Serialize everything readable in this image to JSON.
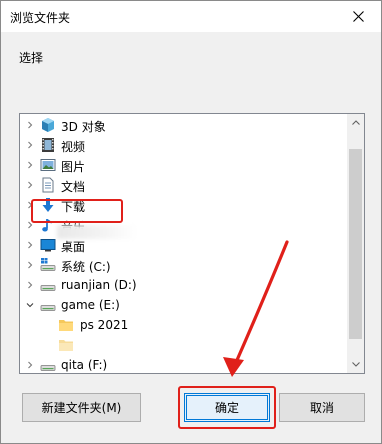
{
  "window": {
    "title": "浏览文件夹"
  },
  "prompt": "选择",
  "tree": {
    "items": [
      {
        "label": "3D 对象",
        "icon": "3d-objects-icon",
        "expanded": false
      },
      {
        "label": "视频",
        "icon": "videos-icon",
        "expanded": false
      },
      {
        "label": "图片",
        "icon": "pictures-icon",
        "expanded": false
      },
      {
        "label": "文档",
        "icon": "documents-icon",
        "expanded": false
      },
      {
        "label": "下载",
        "icon": "downloads-icon",
        "expanded": false
      },
      {
        "label": "音乐",
        "icon": "music-icon",
        "expanded": false
      },
      {
        "label": "桌面",
        "icon": "desktop-icon",
        "expanded": false
      },
      {
        "label": "系统 (C:)",
        "icon": "drive-icon",
        "expanded": false
      },
      {
        "label": "ruanjian (D:)",
        "icon": "drive-icon",
        "expanded": false
      },
      {
        "label": "game (E:)",
        "icon": "drive-icon",
        "expanded": true
      },
      {
        "label": "ps 2021",
        "icon": "folder-icon",
        "expanded": false
      },
      {
        "label": "qita (F:)",
        "icon": "drive-icon",
        "expanded": false
      }
    ]
  },
  "buttons": {
    "new_folder": "新建文件夹(M)",
    "ok": "确定",
    "cancel": "取消"
  },
  "colors": {
    "annotation": "#e0201a",
    "accent": "#0078d7",
    "folder": "#f5c85b"
  }
}
